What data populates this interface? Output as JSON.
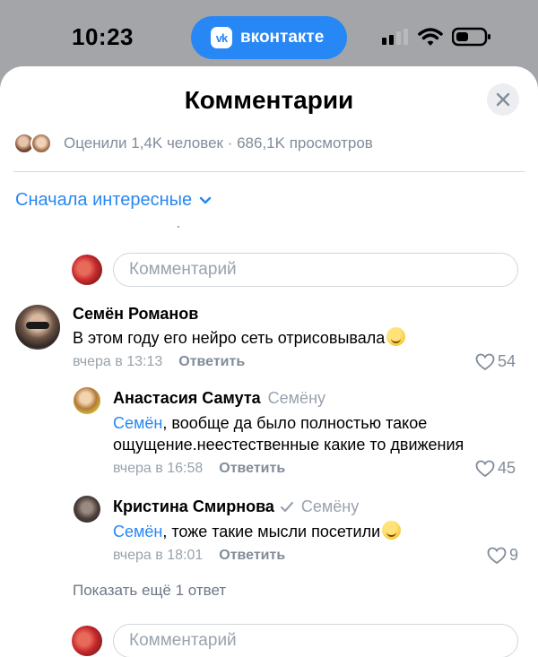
{
  "status_bar": {
    "time": "10:23",
    "app_pill": "вконтакте",
    "logo_letters": "vk"
  },
  "sheet": {
    "title": "Комментарии",
    "stats": "Оценили 1,4K человек · 686,1K просмотров",
    "sort_label": "Сначала интересные",
    "input_placeholder": "Комментарий"
  },
  "comments": [
    {
      "author": "Семён Романов",
      "text": "В этом году его нейро сеть отрисовывала",
      "date": "вчера в 13:13",
      "reply_label": "Ответить",
      "likes": "54"
    }
  ],
  "replies": [
    {
      "author": "Анастасия Самута",
      "reply_to": "Семёну",
      "mention": "Семён",
      "text_line1": ", вообще да было полностью такое",
      "text_line2": "ощущение.неестественные какие то движения",
      "date": "вчера в 16:58",
      "reply_label": "Ответить",
      "likes": "45"
    },
    {
      "author": "Кристина Смирнова",
      "reply_to": "Семёну",
      "mention": "Семён",
      "text": ", тоже такие мысли посетили",
      "date": "вчера в 18:01",
      "reply_label": "Ответить",
      "likes": "9"
    }
  ],
  "show_more": "Показать ещё 1 ответ",
  "colors": {
    "accent": "#2787f5",
    "secondary_text": "#818c99",
    "backdrop": "#a3a5a9"
  },
  "icons": [
    "vk-logo-icon",
    "signal-icon",
    "wifi-icon",
    "battery-icon",
    "close-icon",
    "chevron-down-icon",
    "heart-icon",
    "verified-icon",
    "emoji-icon"
  ]
}
